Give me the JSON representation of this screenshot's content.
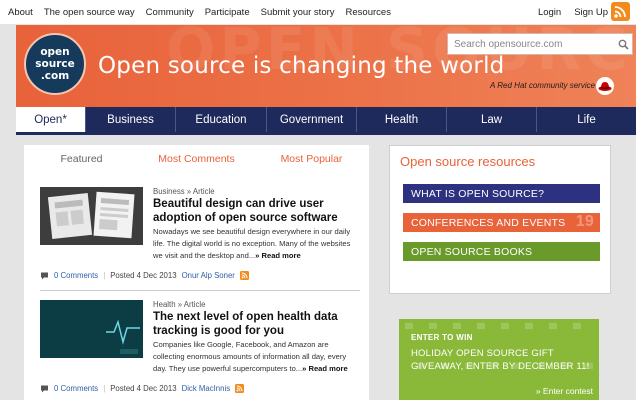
{
  "topnav": {
    "left": [
      "About",
      "The open source way",
      "Community",
      "Participate",
      "Submit your story",
      "Resources"
    ],
    "login": "Login",
    "signup": "Sign Up",
    "rss_icon": "rss-icon"
  },
  "header": {
    "logo_lines": [
      "open",
      "source",
      ".com"
    ],
    "tagline": "Open source is changing the world",
    "search_placeholder": "Search opensource.com",
    "redhat_text": "A Red Hat community service",
    "accent": "#e8623a"
  },
  "nav": {
    "tabs": [
      "Open*",
      "Business",
      "Education",
      "Government",
      "Health",
      "Law",
      "Life"
    ],
    "active": "Open*",
    "color": "#1f2a5c"
  },
  "feed": {
    "tabs": [
      "Featured",
      "Most Comments",
      "Most Popular"
    ],
    "selected": "Featured",
    "articles": [
      {
        "category": "Business",
        "type": "Article",
        "title": "Beautiful design can drive user adoption of open source software",
        "summary": "Nowadays we see beautiful design everywhere in our daily life. The digital world is no exception. Many of the websites we visit and the desktop and...",
        "read_more": "» Read more",
        "comments": "0 Comments",
        "posted": "Posted 4 Dec 2013",
        "author": "Onur Alp Soner"
      },
      {
        "category": "Health",
        "type": "Article",
        "title": "The next level of open health data tracking is good for you",
        "summary": "Companies like Google, Facebook, and Amazon are collecting enormous amounts of information all day, every day. They use powerful supercomputers to...",
        "read_more": "» Read more",
        "comments": "0 Comments",
        "posted": "Posted 4 Dec 2013",
        "author": "Dick MacInnis"
      }
    ]
  },
  "sidebar": {
    "title": "Open source resources",
    "resources": [
      {
        "label": "WHAT IS OPEN SOURCE?",
        "color": "#2e3180"
      },
      {
        "label": "CONFERENCES AND EVENTS",
        "color": "#e8623a",
        "badge": "19"
      },
      {
        "label": "OPEN SOURCE BOOKS",
        "color": "#6a9a2a"
      }
    ]
  },
  "promo": {
    "enter": "ENTER TO WIN",
    "headline": "HOLIDAY OPEN SOURCE GIFT GIVEAWAY, ENTER BY DECEMBER 11!",
    "cta": "» Enter contest",
    "color": "#8ab93a"
  }
}
